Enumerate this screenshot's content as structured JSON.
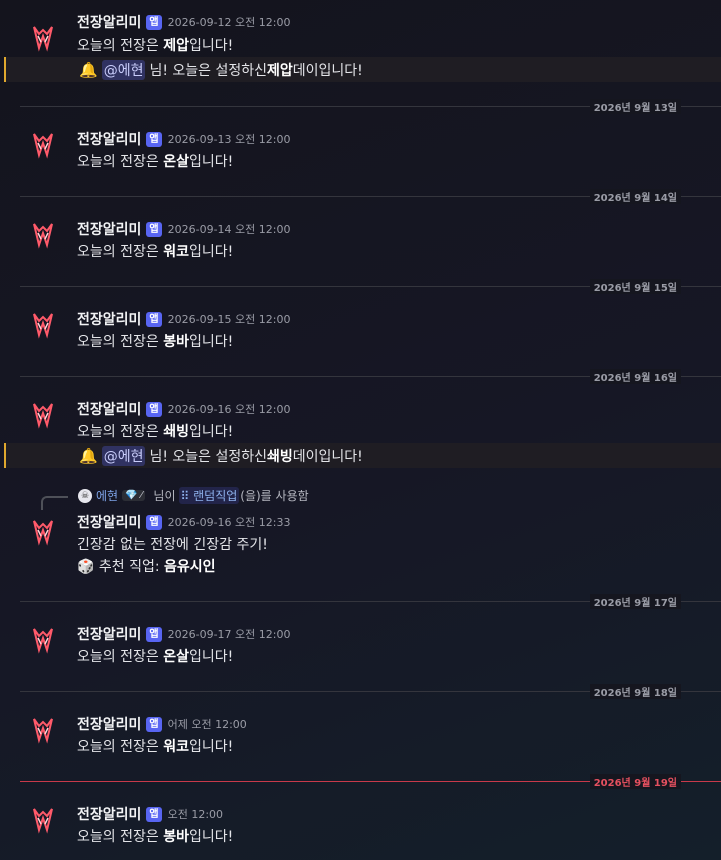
{
  "bot": {
    "name": "전장알리미",
    "tag": "앱"
  },
  "messages": [
    {
      "ts": "2026-09-12 오전 12:00",
      "pre": "오늘의 전장은 ",
      "bold": "제압",
      "post": "입니다!",
      "mention": {
        "user": "@에현",
        "pre": " 님! 오늘은 설정하신 ",
        "bold": "제압",
        "post": " 데이입니다!"
      }
    },
    {
      "ts": "2026-09-13 오전 12:00",
      "pre": "오늘의 전장은 ",
      "bold": "온살",
      "post": "입니다!"
    },
    {
      "ts": "2026-09-14 오전 12:00",
      "pre": "오늘의 전장은 ",
      "bold": "워코",
      "post": "입니다!"
    },
    {
      "ts": "2026-09-15 오전 12:00",
      "pre": "오늘의 전장은 ",
      "bold": "봉바",
      "post": "입니다!"
    },
    {
      "ts": "2026-09-16 오전 12:00",
      "pre": "오늘의 전장은 ",
      "bold": "쇄빙",
      "post": "입니다!",
      "mention": {
        "user": "@에현",
        "pre": " 님! 오늘은 설정하신 ",
        "bold": "쇄빙",
        "post": " 데이입니다!"
      }
    },
    {
      "ts": "2026-09-16 오전 12:33",
      "line1": "긴장감 없는 전장에 긴장감 주기!",
      "line2_pre": " 추천 직업: ",
      "line2_bold": "음유시인"
    },
    {
      "ts": "2026-09-17 오전 12:00",
      "pre": "오늘의 전장은 ",
      "bold": "온살",
      "post": "입니다!"
    },
    {
      "ts": "어제 오전 12:00",
      "pre": "오늘의 전장은 ",
      "bold": "워코",
      "post": "입니다!"
    },
    {
      "ts": "오전 12:00",
      "pre": "오늘의 전장은 ",
      "bold": "봉바",
      "post": "입니다!"
    }
  ],
  "dividers": [
    "2026년 9월 13일",
    "2026년 9월 14일",
    "2026년 9월 15일",
    "2026년 9월 16일",
    "2026년 9월 17일",
    "2026년 9월 18일",
    "2026년 9월 19일"
  ],
  "reply": {
    "user": "에현",
    "badge": "💎 ⁄",
    "pre": "님이",
    "command": "랜덤직업",
    "post": "(을)를 사용함"
  },
  "colors": {
    "brand": "#5865f2",
    "new_divider": "#c8394a",
    "mention_bar": "#e0a82e"
  }
}
